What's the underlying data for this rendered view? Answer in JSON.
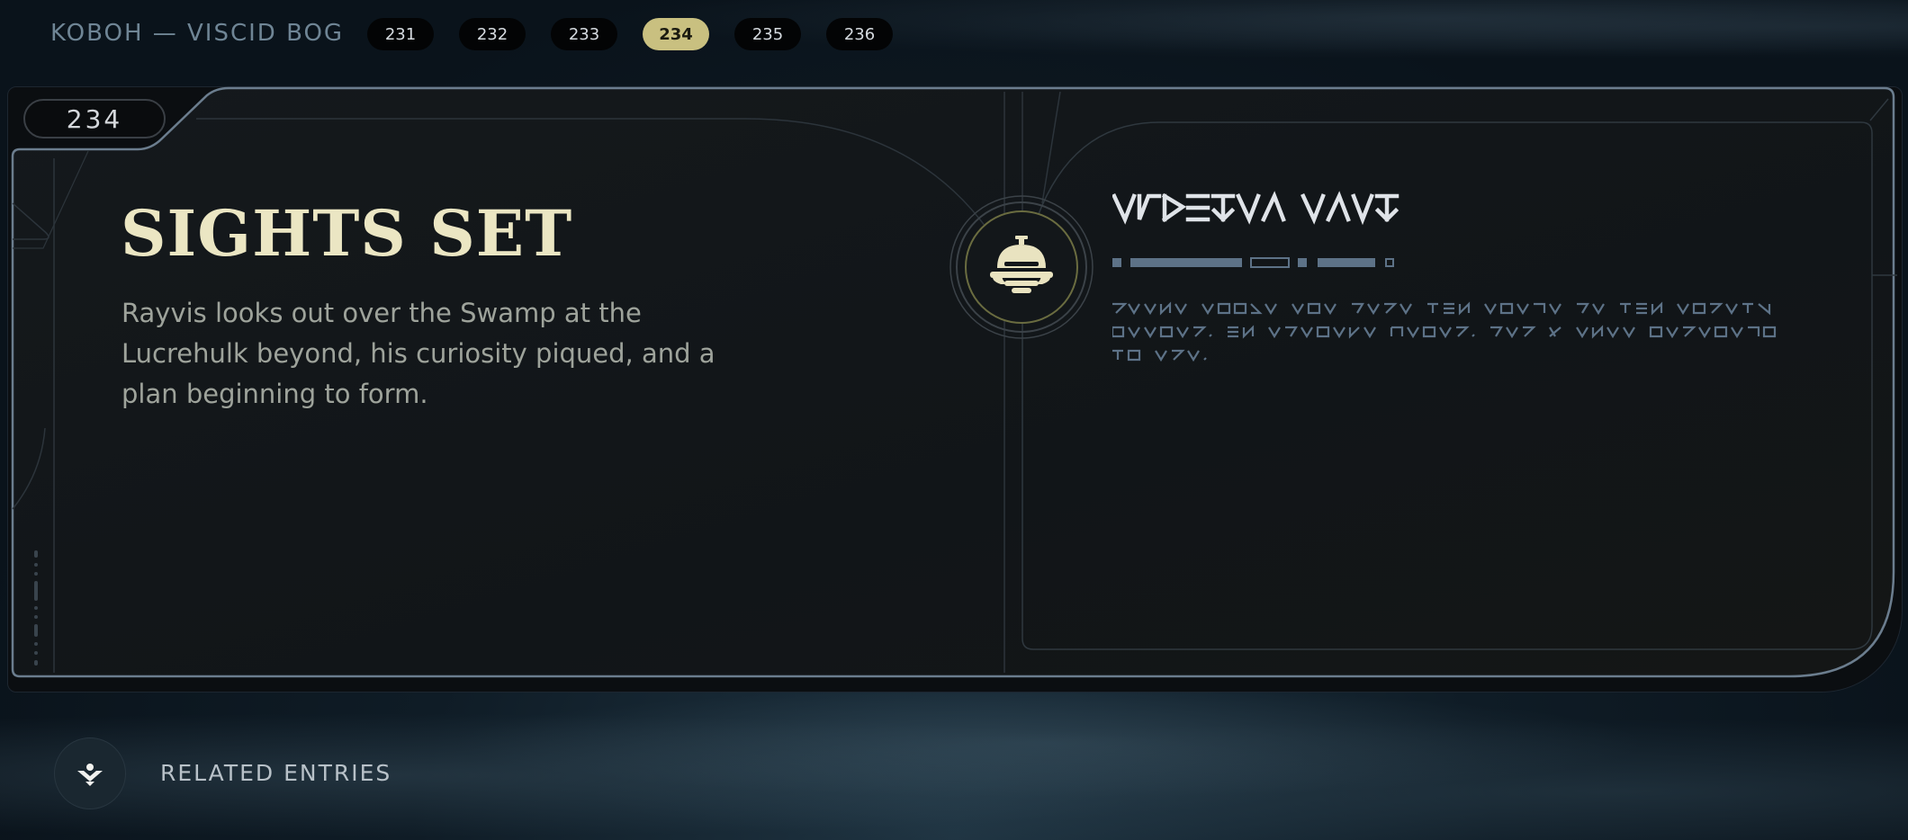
{
  "header": {
    "location": "KOBOH — VISCID BOG",
    "pages": [
      "231",
      "232",
      "233",
      "234",
      "235",
      "236"
    ],
    "active_page": "234"
  },
  "entry": {
    "number": "234",
    "title": "SIGHTS SET",
    "description": "Rayvis looks out over the Swamp at the Lucrehulk beyond, his curiosity piqued, and a plan beginning to form."
  },
  "footer": {
    "related_label": "RELATED ENTRIES"
  },
  "colors": {
    "accent": "#c9c080",
    "title": "#ebe6c3",
    "aurebesh": "#5d7287"
  },
  "icons": {
    "emblem": "rayvis-helmet-icon",
    "related": "related-entries-icon"
  }
}
